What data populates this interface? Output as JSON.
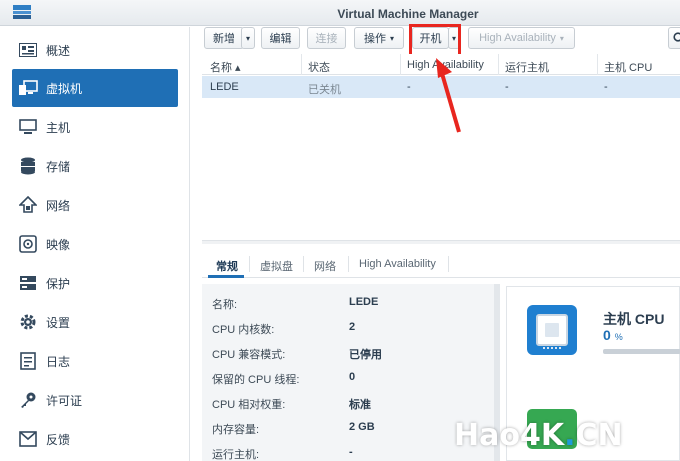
{
  "window": {
    "title": "Virtual Machine Manager"
  },
  "sidebar": {
    "items": [
      {
        "label": "概述",
        "icon": "overview-icon"
      },
      {
        "label": "虚拟机",
        "icon": "virtual-machine-icon",
        "active": true
      },
      {
        "label": "主机",
        "icon": "host-icon"
      },
      {
        "label": "存储",
        "icon": "storage-icon"
      },
      {
        "label": "网络",
        "icon": "network-icon"
      },
      {
        "label": "映像",
        "icon": "image-icon"
      },
      {
        "label": "保护",
        "icon": "protection-icon"
      },
      {
        "label": "设置",
        "icon": "gear-icon"
      },
      {
        "label": "日志",
        "icon": "log-icon"
      },
      {
        "label": "许可证",
        "icon": "key-icon"
      },
      {
        "label": "反馈",
        "icon": "feedback-icon"
      }
    ]
  },
  "toolbar": {
    "create": "新增",
    "edit": "编辑",
    "connect": "连接",
    "action": "操作",
    "power_on": "开机",
    "high_availability": "High Availability"
  },
  "table": {
    "columns": [
      "名称",
      "状态",
      "High Availability",
      "运行主机",
      "主机 CPU"
    ],
    "rows": [
      {
        "name": "LEDE",
        "status": "已关机",
        "ha": "-",
        "host": "-",
        "cpu": "-"
      }
    ]
  },
  "detail": {
    "tabs": [
      "常规",
      "虚拟盘",
      "网络",
      "High Availability"
    ],
    "properties": [
      {
        "label": "名称:",
        "value": "LEDE"
      },
      {
        "label": "CPU 内核数:",
        "value": "2"
      },
      {
        "label": "CPU 兼容模式:",
        "value": "已停用"
      },
      {
        "label": "保留的 CPU 线程:",
        "value": "0"
      },
      {
        "label": "CPU 相对权重:",
        "value": "标准"
      },
      {
        "label": "内存容量:",
        "value": "2 GB"
      },
      {
        "label": "运行主机:",
        "value": "-"
      }
    ],
    "cpu_card": {
      "title": "主机 CPU",
      "value": "0",
      "unit": "%"
    }
  },
  "watermark": {
    "main": "Hao4K",
    "dot": ".",
    "tld": "CN"
  },
  "colors": {
    "accent": "#1f6fb5",
    "selected_row": "#d9e8f7",
    "annotation": "#e8261f"
  }
}
